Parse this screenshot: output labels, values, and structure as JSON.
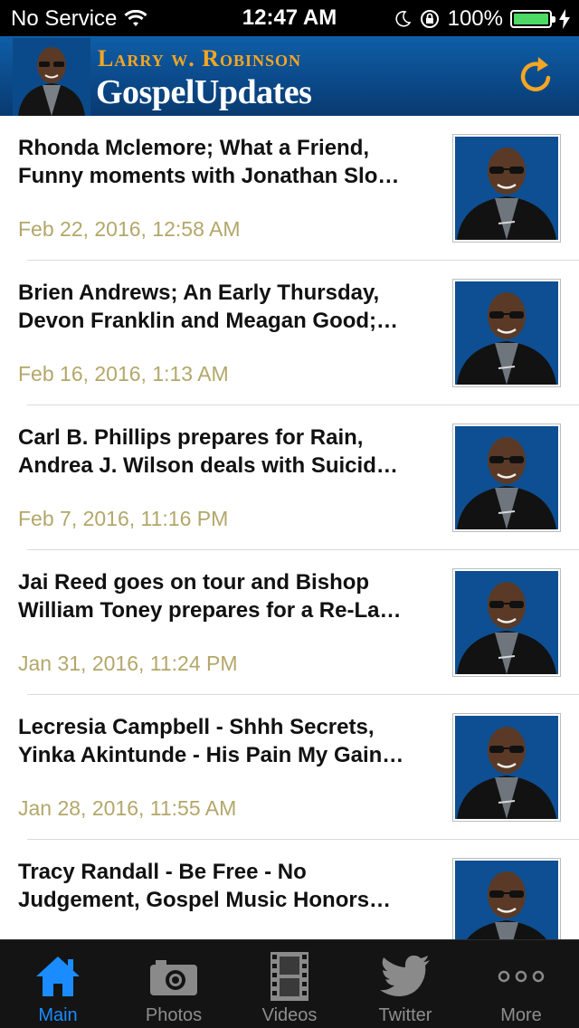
{
  "status_bar": {
    "carrier": "No Service",
    "time": "12:47 AM",
    "battery": "100%",
    "battery_level": 1.0
  },
  "header": {
    "brand_name": "Larry w. Robinson",
    "app_title": "GospelUpdates"
  },
  "feed": {
    "items": [
      {
        "title": "Rhonda Mclemore; What a Friend,\nFunny moments with Jonathan Slo…",
        "date": "Feb 22, 2016, 12:58 AM"
      },
      {
        "title": "Brien Andrews; An Early Thursday,\nDevon Franklin and Meagan Good;…",
        "date": "Feb 16, 2016, 1:13 AM"
      },
      {
        "title": "Carl B. Phillips prepares for Rain,\nAndrea J. Wilson deals with Suicid…",
        "date": "Feb 7, 2016, 11:16 PM"
      },
      {
        "title": "Jai Reed goes on tour and Bishop\nWilliam Toney prepares for a Re-La…",
        "date": "Jan 31, 2016, 11:24 PM"
      },
      {
        "title": "Lecresia Campbell - Shhh Secrets,\nYinka Akintunde - His Pain My Gain…",
        "date": "Jan 28, 2016, 11:55 AM"
      },
      {
        "title": "Tracy Randall - Be Free - No\nJudgement, Gospel Music Honors…",
        "date": ""
      }
    ]
  },
  "tabbar": {
    "tabs": [
      {
        "label": "Main",
        "icon": "home-icon",
        "active": true
      },
      {
        "label": "Photos",
        "icon": "camera-icon",
        "active": false
      },
      {
        "label": "Videos",
        "icon": "film-icon",
        "active": false
      },
      {
        "label": "Twitter",
        "icon": "twitter-bird-icon",
        "active": false
      },
      {
        "label": "More",
        "icon": "more-dots-icon",
        "active": false
      }
    ]
  },
  "colors": {
    "header_blue": "#0b4a8a",
    "brand_orange": "#f5a623",
    "date_text": "#b3a76a",
    "tab_active": "#1a8cff",
    "battery_green": "#4cd964"
  }
}
